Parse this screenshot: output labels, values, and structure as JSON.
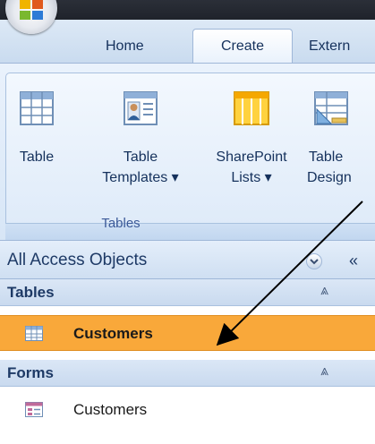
{
  "ribbon_tabs": [
    "Home",
    "Create",
    "Extern"
  ],
  "active_tab": "Create",
  "ribbon_buttons": [
    {
      "line1": "Table",
      "line2": "",
      "icon": "table-icon"
    },
    {
      "line1": "Table",
      "line2": "Templates ▾",
      "icon": "table-templates-icon"
    },
    {
      "line1": "SharePoint",
      "line2": "Lists ▾",
      "icon": "sharepoint-lists-icon"
    },
    {
      "line1": "Table",
      "line2": "Design",
      "icon": "table-design-icon"
    }
  ],
  "ribbon_group_label": "Tables",
  "nav": {
    "title": "All Access Objects",
    "collapse_glyph": "«",
    "sections": [
      {
        "title": "Tables",
        "chevron": "⩓",
        "items": [
          {
            "label": "Customers",
            "icon": "table-icon",
            "selected": true
          }
        ]
      },
      {
        "title": "Forms",
        "chevron": "⩓",
        "items": [
          {
            "label": "Customers",
            "icon": "form-icon",
            "selected": false
          }
        ]
      }
    ]
  },
  "colors": {
    "selected_item": "#f9a83a",
    "ribbon_text": "#15315c",
    "nav_header": "#dbe7f6"
  }
}
